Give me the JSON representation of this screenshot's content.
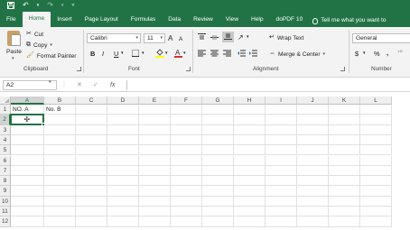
{
  "qat": {
    "save_icon": "save-icon",
    "undo_icon": "undo-icon",
    "redo_icon": "redo-icon"
  },
  "tabs": [
    {
      "label": "File"
    },
    {
      "label": "Home"
    },
    {
      "label": "Insert"
    },
    {
      "label": "Page Layout"
    },
    {
      "label": "Formulas"
    },
    {
      "label": "Data"
    },
    {
      "label": "Review"
    },
    {
      "label": "View"
    },
    {
      "label": "Help"
    },
    {
      "label": "doPDF 10"
    }
  ],
  "tell_me": "Tell me what you want to",
  "ribbon": {
    "clipboard": {
      "paste": "Paste",
      "cut": "Cut",
      "copy": "Copy",
      "format_painter": "Format Painter",
      "group": "Clipboard"
    },
    "font": {
      "name": "Calibri",
      "size": "11",
      "grow": "A",
      "shrink": "A",
      "bold": "B",
      "italic": "I",
      "underline": "U",
      "group": "Font"
    },
    "alignment": {
      "wrap_text": "Wrap Text",
      "merge_center": "Merge & Center",
      "group": "Alignment"
    },
    "number": {
      "format": "General",
      "currency": "$",
      "percent": "%",
      "comma": ",",
      "group": "Number"
    }
  },
  "formula_bar": {
    "name_box": "A2",
    "fx": "fx",
    "cancel": "✕",
    "enter": "✓",
    "value": ""
  },
  "columns": [
    "A",
    "B",
    "C",
    "D",
    "E",
    "F",
    "G",
    "H",
    "I",
    "J",
    "K",
    "L"
  ],
  "rows": [
    "1",
    "2",
    "3",
    "4",
    "5",
    "6",
    "7",
    "8",
    "9",
    "10",
    "11",
    "12"
  ],
  "cells": {
    "A1": "NO. A",
    "B1": "No. B"
  },
  "active_cell": "A2",
  "colors": {
    "excel_green": "#217346",
    "ribbon_bg": "#f3f3f3",
    "grid_line": "#e1e1e1"
  }
}
